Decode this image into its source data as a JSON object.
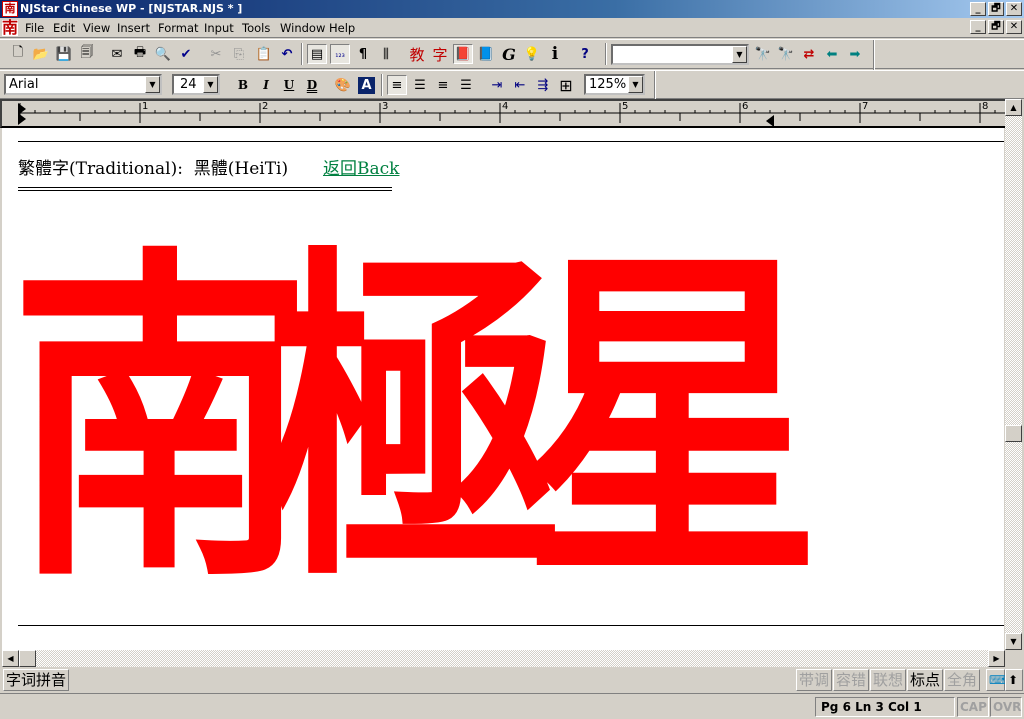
{
  "window": {
    "title": "NJStar Chinese WP - [NJSTAR.NJS * ]",
    "app_icon_glyph": "南",
    "controls": {
      "minimize": "_",
      "restore": "🗗",
      "close": "✕"
    }
  },
  "menu": {
    "items": [
      "File",
      "Edit",
      "View",
      "Insert",
      "Format",
      "Input",
      "Tools",
      "Window",
      "Help"
    ]
  },
  "toolbar1": {
    "buttons": [
      {
        "name": "new-icon",
        "glyph": "🗋"
      },
      {
        "name": "open-icon",
        "glyph": "📂"
      },
      {
        "name": "save-icon",
        "glyph": "💾"
      },
      {
        "name": "save-all-icon",
        "glyph": "🗐"
      },
      {
        "name": "mail-icon",
        "glyph": "✉"
      },
      {
        "name": "print-icon",
        "glyph": "🖶"
      },
      {
        "name": "print-preview-icon",
        "glyph": "🔍"
      },
      {
        "name": "spellcheck-icon",
        "glyph": "✔"
      },
      {
        "name": "cut-icon",
        "glyph": "✂"
      },
      {
        "name": "copy-icon",
        "glyph": "⎘"
      },
      {
        "name": "paste-icon",
        "glyph": "📋"
      },
      {
        "name": "undo-icon",
        "glyph": "↶"
      },
      {
        "name": "page-view-icon",
        "glyph": "▤"
      },
      {
        "name": "numbering-icon",
        "glyph": "₁₂₃"
      },
      {
        "name": "paragraph-mark-icon",
        "glyph": "¶"
      },
      {
        "name": "column-icon",
        "glyph": "⫼"
      },
      {
        "name": "simplified-char-icon",
        "glyph": "教"
      },
      {
        "name": "traditional-char-icon",
        "glyph": "字"
      },
      {
        "name": "chinese-dictionary-icon",
        "glyph": "📕"
      },
      {
        "name": "english-dictionary-icon",
        "glyph": "📘"
      },
      {
        "name": "grammar-icon",
        "glyph": "G"
      },
      {
        "name": "tip-icon",
        "glyph": "💡"
      },
      {
        "name": "info-icon",
        "glyph": "i"
      },
      {
        "name": "context-help-icon",
        "glyph": "?"
      }
    ],
    "search_combo_value": "",
    "find_buttons": [
      {
        "name": "find-next-icon",
        "glyph": "🔭"
      },
      {
        "name": "find-prev-icon",
        "glyph": "🔭"
      },
      {
        "name": "replace-icon",
        "glyph": "⇄"
      },
      {
        "name": "back-arrow-icon",
        "glyph": "⬅"
      },
      {
        "name": "forward-arrow-icon",
        "glyph": "➡"
      }
    ]
  },
  "toolbar2": {
    "font": "Arial",
    "size": "24",
    "bold": "B",
    "italic": "I",
    "underline": "U",
    "double_underline": "D",
    "color_glyph": "🎨",
    "highlight_glyph": "A",
    "zoom": "125%"
  },
  "ruler": {
    "labels": [
      "1",
      "2",
      "3",
      "4",
      "5",
      "6",
      "7",
      "8"
    ]
  },
  "document": {
    "line1_label": "繁體字(Traditional):  黑體(HeiTi)",
    "back_link": "返回Back",
    "big_text": [
      "南",
      "極",
      "星"
    ],
    "big_text_color": "#ff0000",
    "link_color": "#008040"
  },
  "ime_bar": {
    "mode_button": "字词拼音",
    "options": [
      {
        "label": "带调",
        "enabled": false
      },
      {
        "label": "容错",
        "enabled": false
      },
      {
        "label": "联想",
        "enabled": false
      },
      {
        "label": "标点",
        "enabled": true
      },
      {
        "label": "全角",
        "enabled": false
      }
    ]
  },
  "statusbar": {
    "position": "Pg 6   Ln 3  Col 1",
    "cap": "CAP",
    "ovr": "OVR"
  }
}
